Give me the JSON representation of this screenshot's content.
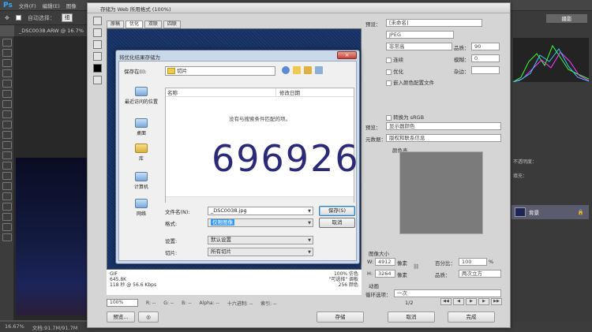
{
  "menubar": {
    "logo": "Ps",
    "items": [
      "文件(F)",
      "编辑(E)",
      "图像"
    ]
  },
  "options": {
    "auto_select_label": "自动选择：",
    "auto_select_value": "组"
  },
  "doc_tab": {
    "label": "_DSC0038.ARW @ 16.7%"
  },
  "statusbar": {
    "zoom": "16.67%",
    "doc": "文档:91.7M/91.7M"
  },
  "right_panel": {
    "workspace": "摄影",
    "layer_name": "背景",
    "opacity_label": "不透明度：",
    "fill_label": "填充："
  },
  "sfw": {
    "title": "存储为 Web 所用格式 (100%)",
    "tabs": [
      "原稿",
      "优化",
      "双联",
      "四联"
    ],
    "preview_info_left": [
      "GIF",
      "645.8K",
      "118 秒 @ 56.6 Kbps"
    ],
    "preview_info_right": [
      "100% 仿色",
      "\"可选择\" 调板",
      "256 颜色"
    ],
    "zoom": "100%",
    "readouts": [
      "R: --",
      "G: --",
      "B: --",
      "Alpha: --",
      "十六进制: --",
      "索引: --"
    ],
    "preset_label": "预设：",
    "preset_value": "[未命名]",
    "format": "JPEG",
    "quality_mode": "非常高",
    "quality_label": "品质：",
    "quality_value": "90",
    "blur_label": "模糊：",
    "blur_value": "0",
    "matte_label": "杂边：",
    "chk_progressive": "连续",
    "chk_optimized": "优化",
    "chk_embed": "嵌入颜色配置文件",
    "chk_srgb": "转换为 sRGB",
    "preview_label": "预览：",
    "preview_value": "显示器颜色",
    "metadata_label": "元数据：",
    "metadata_value": "版权和联系信息",
    "colortable_label": "颜色表",
    "imagesize_label": "图像大小",
    "width_label": "W:",
    "width_value": "4912",
    "height_label": "H:",
    "height_value": "3264",
    "px": "像素",
    "percent_label": "百分比：",
    "percent_value": "100",
    "percent_unit": "%",
    "quality2_label": "品质：",
    "quality2_value": "两次立方",
    "anim_label": "动画",
    "loop_label": "循环选项：",
    "loop_value": "一次",
    "frame": "1/2",
    "btn_preview": "预览...",
    "btn_save": "存储",
    "btn_cancel": "取消",
    "btn_done": "完成"
  },
  "save_dialog": {
    "title": "将优化结果存储为",
    "close": "×",
    "look_in_label": "保存在(I):",
    "look_in_value": "切片",
    "places": [
      "最近访问的位置",
      "桌面",
      "库",
      "计算机",
      "网络"
    ],
    "col_name": "名称",
    "col_date": "修改日期",
    "empty_msg": "没有与搜索条件匹配的项。",
    "filename_label": "文件名(N):",
    "filename_value": "_DSC0038.jpg",
    "format_label": "格式:",
    "format_value": "仅限图像",
    "settings_label": "设置:",
    "settings_value": "默认设置",
    "slices_label": "切片:",
    "slices_value": "所有切片",
    "btn_save": "保存(S)",
    "btn_cancel": "取消"
  },
  "watermark": "696926",
  "colors": {
    "accent": "#31a8ff",
    "preview_blue": "#1f3a6e",
    "dialog_frame": "#c9d9ea",
    "watermark": "#2b2a78"
  }
}
